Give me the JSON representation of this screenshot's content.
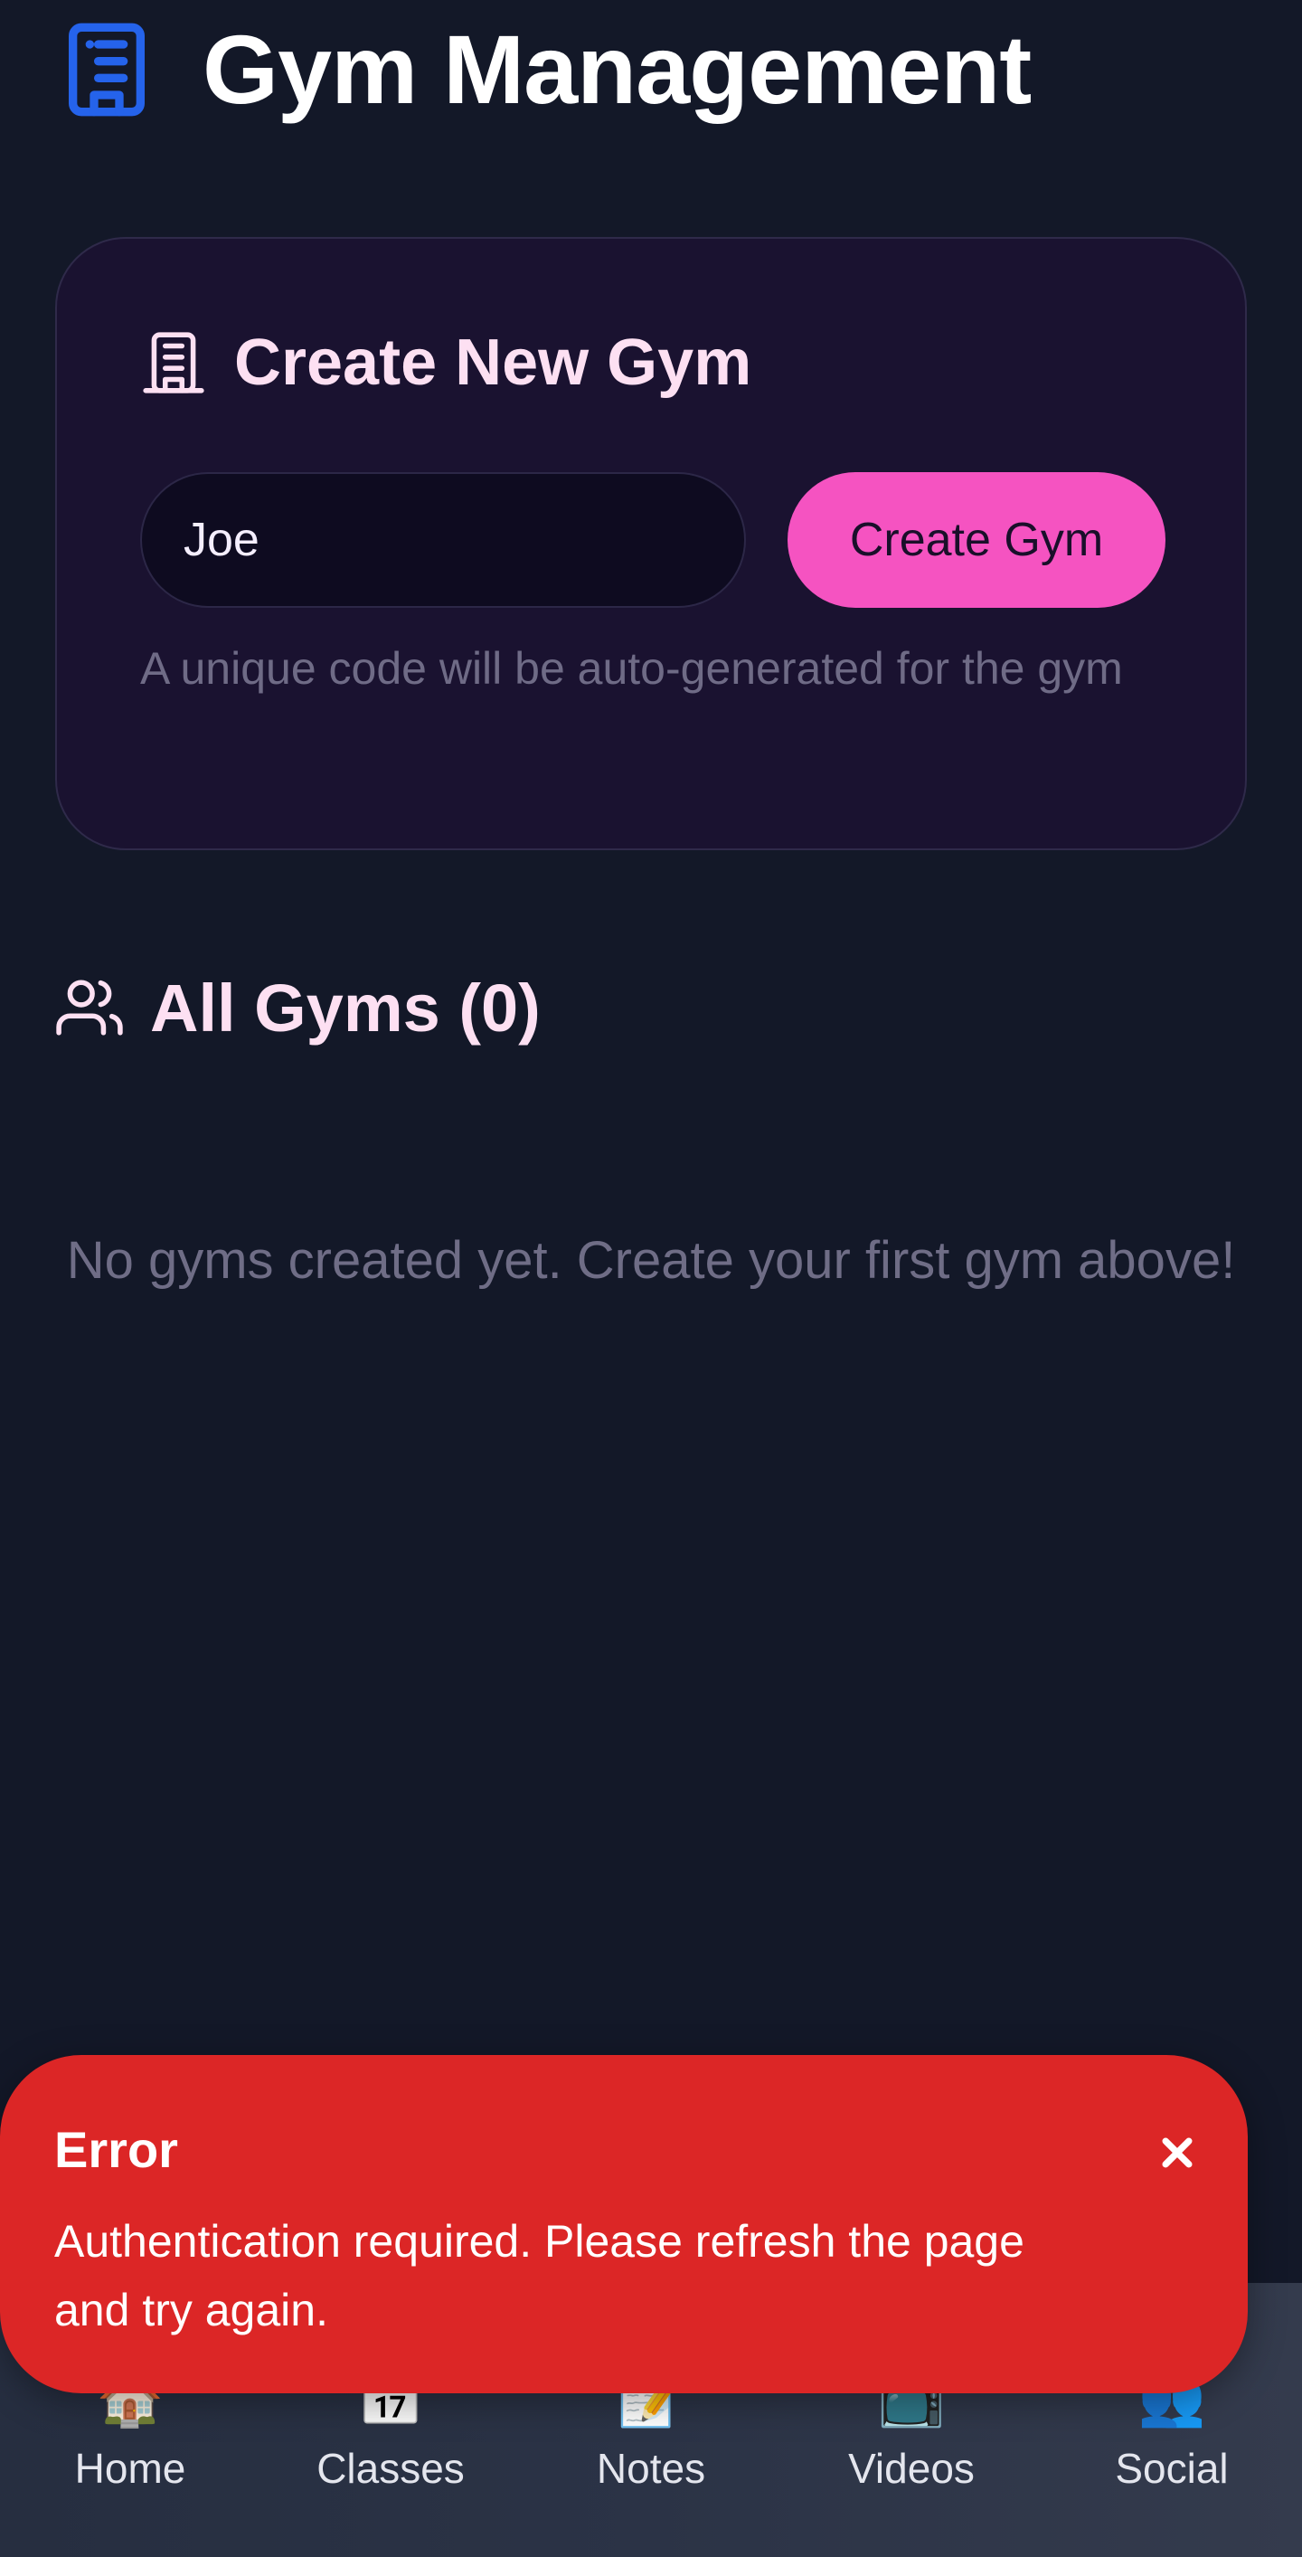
{
  "header": {
    "icon": "building-icon",
    "title": "Gym Management"
  },
  "create_gym": {
    "icon": "building-icon",
    "title": "Create New Gym",
    "input_value": "Joe",
    "button_label": "Create Gym",
    "helper_text": "A unique code will be auto-generated for the gym"
  },
  "all_gyms": {
    "icon": "users-icon",
    "title": "All Gyms (0)",
    "empty_message": "No gyms created yet. Create your first gym above!"
  },
  "bottom_nav": {
    "items": [
      {
        "label": "Home",
        "icon": "house-emoji-icon"
      },
      {
        "label": "Classes",
        "icon": "calendar-emoji-icon"
      },
      {
        "label": "Notes",
        "icon": "memo-emoji-icon"
      },
      {
        "label": "Videos",
        "icon": "tv-emoji-icon"
      },
      {
        "label": "Social",
        "icon": "people-emoji-icon"
      }
    ]
  },
  "error_toast": {
    "title": "Error",
    "message": "Authentication required. Please refresh the page and try again.",
    "close_icon": "close-icon"
  },
  "colors": {
    "background": "#131828",
    "accent_pink": "#f553c1",
    "accent_blue": "#2563eb",
    "error_red": "#dc2626",
    "card_background": "#1a1230"
  }
}
